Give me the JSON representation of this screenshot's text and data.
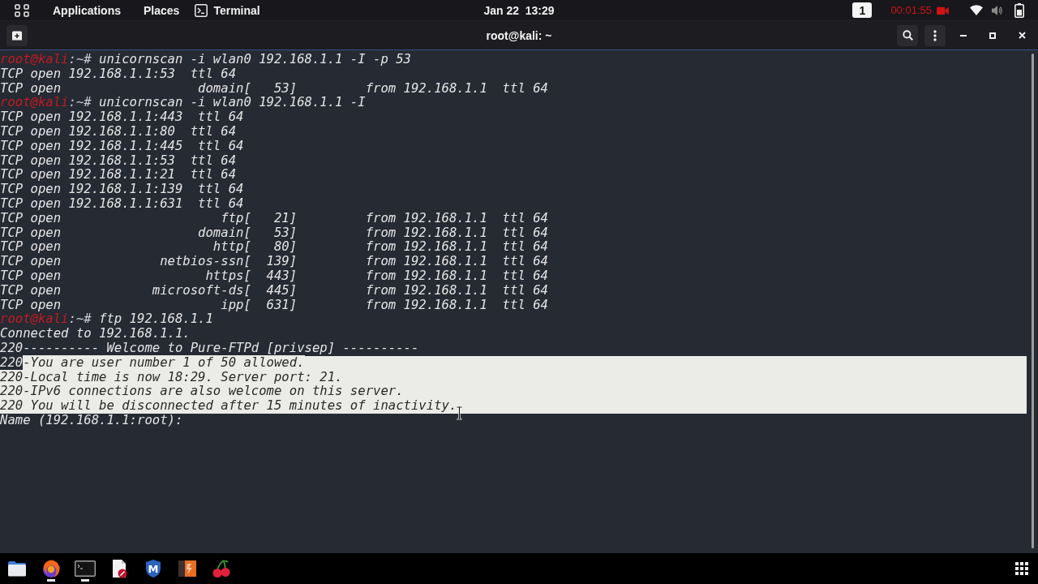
{
  "top_panel": {
    "menus": [
      {
        "label": "Applications"
      },
      {
        "label": "Places"
      }
    ],
    "app_menu": {
      "label": "Terminal"
    },
    "clock": "Jan 22  13:29",
    "workspace": "1",
    "recording_timer": "00:01:55"
  },
  "window": {
    "title": "root@kali: ~"
  },
  "terminal": {
    "lines": [
      {
        "kind": "prompt",
        "user": "root@kali",
        "path": ":~#",
        "command": "unicornscan -i wlan0 192.168.1.1 -I -p 53"
      },
      {
        "kind": "output",
        "parts": [
          {
            "text": "TCP open 192.168.1.1:53  ttl 64",
            "selected": false
          }
        ]
      },
      {
        "kind": "output",
        "parts": [
          {
            "text": "TCP open                  domain[   53]         from 192.168.1.1  ttl 64",
            "selected": false
          }
        ]
      },
      {
        "kind": "prompt",
        "user": "root@kali",
        "path": ":~#",
        "command": "unicornscan -i wlan0 192.168.1.1 -I"
      },
      {
        "kind": "output",
        "parts": [
          {
            "text": "TCP open 192.168.1.1:443  ttl 64",
            "selected": false
          }
        ]
      },
      {
        "kind": "output",
        "parts": [
          {
            "text": "TCP open 192.168.1.1:80  ttl 64",
            "selected": false
          }
        ]
      },
      {
        "kind": "output",
        "parts": [
          {
            "text": "TCP open 192.168.1.1:445  ttl 64",
            "selected": false
          }
        ]
      },
      {
        "kind": "output",
        "parts": [
          {
            "text": "TCP open 192.168.1.1:53  ttl 64",
            "selected": false
          }
        ]
      },
      {
        "kind": "output",
        "parts": [
          {
            "text": "TCP open 192.168.1.1:21  ttl 64",
            "selected": false
          }
        ]
      },
      {
        "kind": "output",
        "parts": [
          {
            "text": "TCP open 192.168.1.1:139  ttl 64",
            "selected": false
          }
        ]
      },
      {
        "kind": "output",
        "parts": [
          {
            "text": "TCP open 192.168.1.1:631  ttl 64",
            "selected": false
          }
        ]
      },
      {
        "kind": "output",
        "parts": [
          {
            "text": "TCP open                     ftp[   21]         from 192.168.1.1  ttl 64",
            "selected": false
          }
        ]
      },
      {
        "kind": "output",
        "parts": [
          {
            "text": "TCP open                  domain[   53]         from 192.168.1.1  ttl 64",
            "selected": false
          }
        ]
      },
      {
        "kind": "output",
        "parts": [
          {
            "text": "TCP open                    http[   80]         from 192.168.1.1  ttl 64",
            "selected": false
          }
        ]
      },
      {
        "kind": "output",
        "parts": [
          {
            "text": "TCP open             netbios-ssn[  139]         from 192.168.1.1  ttl 64",
            "selected": false
          }
        ]
      },
      {
        "kind": "output",
        "parts": [
          {
            "text": "TCP open                   https[  443]         from 192.168.1.1  ttl 64",
            "selected": false
          }
        ]
      },
      {
        "kind": "output",
        "parts": [
          {
            "text": "TCP open            microsoft-ds[  445]         from 192.168.1.1  ttl 64",
            "selected": false
          }
        ]
      },
      {
        "kind": "output",
        "parts": [
          {
            "text": "TCP open                     ipp[  631]         from 192.168.1.1  ttl 64",
            "selected": false
          }
        ]
      },
      {
        "kind": "prompt",
        "user": "root@kali",
        "path": ":~#",
        "command": "ftp 192.168.1.1"
      },
      {
        "kind": "output",
        "parts": [
          {
            "text": "Connected to 192.168.1.1.",
            "selected": false
          }
        ]
      },
      {
        "kind": "output",
        "parts": [
          {
            "text": "220---------- Welcome to Pure-FTPd [privsep] ----------",
            "selected": false
          }
        ]
      },
      {
        "kind": "output",
        "parts": [
          {
            "text": "220",
            "selected": false
          },
          {
            "text": "-You are user number 1 of 50 allowed.",
            "selected": true
          }
        ]
      },
      {
        "kind": "output",
        "parts": [
          {
            "text": "220-Local time is now 18:29. Server port: 21.",
            "selected": true
          }
        ]
      },
      {
        "kind": "output",
        "parts": [
          {
            "text": "220-IPv6 connections are also welcome on this server.",
            "selected": true
          }
        ]
      },
      {
        "kind": "output",
        "parts": [
          {
            "text": "220 You will be disconnected after 15 minutes of inactivity.",
            "selected": true
          }
        ]
      },
      {
        "kind": "output",
        "parts": [
          {
            "text": "Name (192.168.1.1:root):",
            "selected": false
          }
        ]
      }
    ]
  },
  "dock": {
    "apps": [
      {
        "kind": "files",
        "running": false
      },
      {
        "kind": "browser",
        "running": true
      },
      {
        "kind": "terminal",
        "running": true
      },
      {
        "kind": "editor",
        "running": false
      },
      {
        "kind": "metasploit",
        "glyph": "M",
        "running": false
      },
      {
        "kind": "burp",
        "running": false
      },
      {
        "kind": "cherry",
        "running": false
      }
    ]
  }
}
